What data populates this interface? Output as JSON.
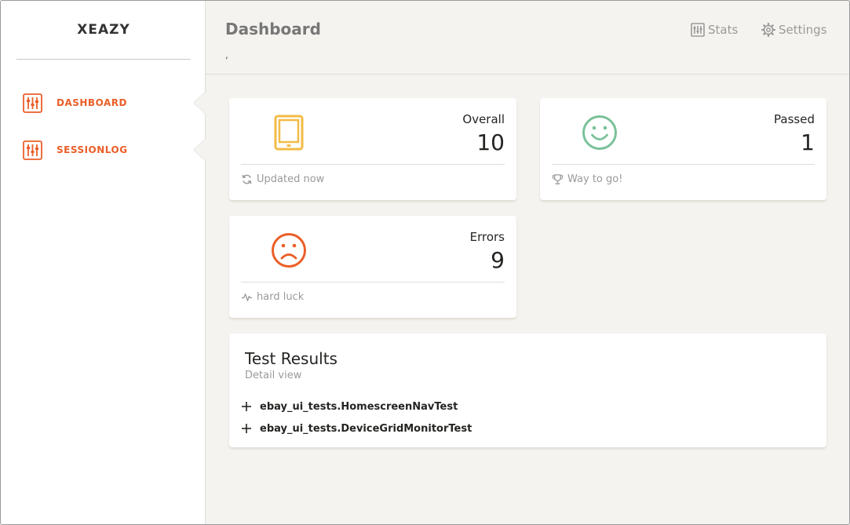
{
  "sidebar": {
    "logo": "XEAZY",
    "items": [
      {
        "label": "DASHBOARD",
        "icon": "sliders-icon"
      },
      {
        "label": "SESSIONLOG",
        "icon": "sliders-icon"
      }
    ]
  },
  "header": {
    "title": "Dashboard",
    "subtitle": ",",
    "nav": [
      {
        "label": "Stats",
        "icon": "chart-icon"
      },
      {
        "label": "Settings",
        "icon": "gear-icon"
      }
    ]
  },
  "stats": {
    "overall": {
      "label": "Overall",
      "value": "10",
      "footer": "Updated now",
      "icon": "tablet-icon",
      "footer_icon": "refresh-icon",
      "color": "#f3bb45"
    },
    "passed": {
      "label": "Passed",
      "value": "1",
      "footer": "Way to go!",
      "icon": "smile-icon",
      "footer_icon": "trophy-icon",
      "color": "#7ac29a"
    },
    "errors": {
      "label": "Errors",
      "value": "9",
      "footer": "hard luck",
      "icon": "frown-icon",
      "footer_icon": "pulse-icon",
      "color": "#eb5e28"
    }
  },
  "results": {
    "title": "Test Results",
    "subtitle": "Detail view",
    "tests": [
      {
        "name": "ebay_ui_tests.HomescreenNavTest"
      },
      {
        "name": "ebay_ui_tests.DeviceGridMonitorTest"
      }
    ]
  },
  "colors": {
    "accent": "#eb5e28",
    "background": "#f4f3ef"
  }
}
